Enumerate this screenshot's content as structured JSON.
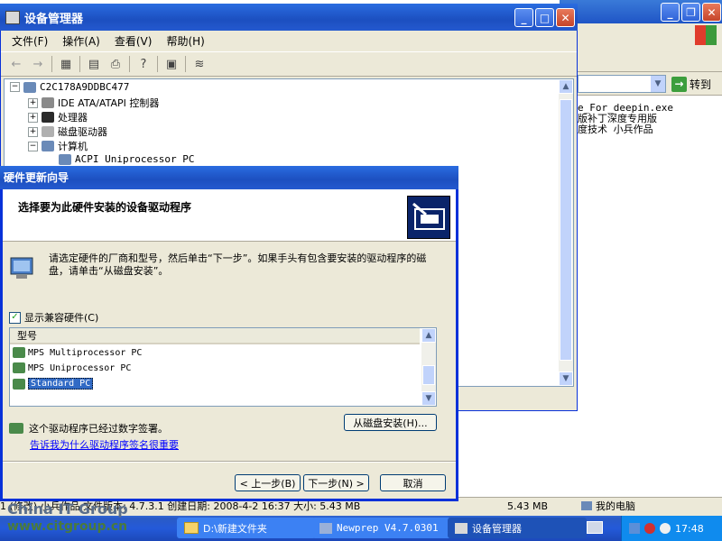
{
  "background_window": {
    "address_go_label": "转到",
    "file_lines": [
      "e_For_deepin.exe",
      "版补丁深度专用版",
      "度技术 小兵作品"
    ],
    "statusbar": {
      "info": "1 (修改) 小兵作品 文件版本: 4.7.3.1 创建日期: 2008-4-2 16:37 大小: 5.43 MB",
      "size": "5.43 MB",
      "location": "我的电脑"
    }
  },
  "device_manager": {
    "title": "设备管理器",
    "menu": [
      "文件(F)",
      "操作(A)",
      "查看(V)",
      "帮助(H)"
    ],
    "tree": {
      "root": "C2C178A9DDBC477",
      "items": [
        {
          "label": "IDE ATA/ATAPI 控制器",
          "expander": "+"
        },
        {
          "label": "处理器",
          "expander": "+"
        },
        {
          "label": "磁盘驱动器",
          "expander": "+"
        },
        {
          "label": "计算机",
          "expander": "−"
        }
      ],
      "child": "ACPI Uniprocessor PC"
    }
  },
  "wizard": {
    "title": "硬件更新向导",
    "heading": "选择要为此硬件安装的设备驱动程序",
    "instruction": "请选定硬件的厂商和型号，然后单击“下一步”。如果手头有包含要安装的驱动程序的磁盘，请单击“从磁盘安装”。",
    "show_compatible": "显示兼容硬件(C)",
    "list_header": "型号",
    "models": [
      "MPS Multiprocessor PC",
      "MPS Uniprocessor PC",
      "Standard PC"
    ],
    "signed_text": "这个驱动程序已经过数字签署。",
    "link_text": "告诉我为什么驱动程序签名很重要",
    "buttons": {
      "from_disk": "从磁盘安装(H)...",
      "back": "< 上一步(B)",
      "next": "下一步(N) >",
      "cancel": "取消"
    }
  },
  "taskbar": {
    "tasks": [
      "D:\\新建文件夹",
      "Newprep V4.7.0301",
      "设备管理器"
    ],
    "clock": "17:48"
  },
  "watermark": {
    "line1": "China IT Group",
    "line2": "www.citgroup.cn"
  },
  "colors": {
    "title_blue": "#1c4fc0",
    "taskbar_blue": "#245ad9",
    "selection": "#316ac5"
  }
}
